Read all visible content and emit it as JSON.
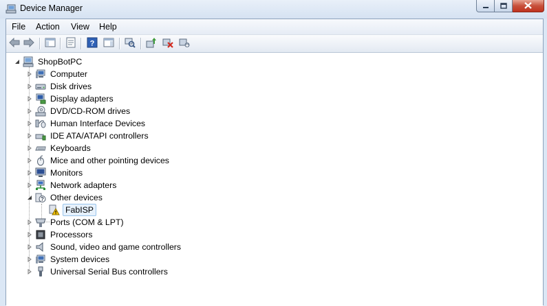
{
  "window": {
    "title": "Device Manager",
    "icon": "device-manager-icon",
    "controls": [
      "minimize-icon",
      "maximize-icon",
      "close-icon"
    ]
  },
  "menu": {
    "items": [
      "File",
      "Action",
      "View",
      "Help"
    ]
  },
  "toolbar": {
    "buttons": [
      "back-arrow-icon",
      "forward-arrow-icon",
      "show-hide-console-tree-icon",
      "properties-icon",
      "help-icon",
      "action-pane-icon",
      "scan-hardware-changes-icon",
      "update-driver-icon",
      "uninstall-icon",
      "disable-icon"
    ]
  },
  "tree": {
    "root": {
      "label": "ShopBotPC",
      "icon": "computer-icon",
      "expanded": true
    },
    "categories": [
      {
        "label": "Computer",
        "icon": "computer-icon",
        "expanded": false
      },
      {
        "label": "Disk drives",
        "icon": "disk-drive-icon",
        "expanded": false
      },
      {
        "label": "Display adapters",
        "icon": "display-adapter-icon",
        "expanded": false
      },
      {
        "label": "DVD/CD-ROM drives",
        "icon": "dvd-drive-icon",
        "expanded": false
      },
      {
        "label": "Human Interface Devices",
        "icon": "hid-icon",
        "expanded": false
      },
      {
        "label": "IDE ATA/ATAPI controllers",
        "icon": "ide-controller-icon",
        "expanded": false
      },
      {
        "label": "Keyboards",
        "icon": "keyboard-icon",
        "expanded": false
      },
      {
        "label": "Mice and other pointing devices",
        "icon": "mouse-icon",
        "expanded": false
      },
      {
        "label": "Monitors",
        "icon": "monitor-icon",
        "expanded": false
      },
      {
        "label": "Network adapters",
        "icon": "network-adapter-icon",
        "expanded": false
      },
      {
        "label": "Other devices",
        "icon": "unknown-device-icon",
        "expanded": true,
        "children": [
          {
            "label": "FabISP",
            "icon": "warning-device-icon",
            "selected": true
          }
        ]
      },
      {
        "label": "Ports (COM & LPT)",
        "icon": "port-icon",
        "expanded": false
      },
      {
        "label": "Processors",
        "icon": "processor-icon",
        "expanded": false
      },
      {
        "label": "Sound, video and game controllers",
        "icon": "sound-icon",
        "expanded": false
      },
      {
        "label": "System devices",
        "icon": "system-device-icon",
        "expanded": false
      },
      {
        "label": "Universal Serial Bus controllers",
        "icon": "usb-icon",
        "expanded": false
      }
    ]
  }
}
